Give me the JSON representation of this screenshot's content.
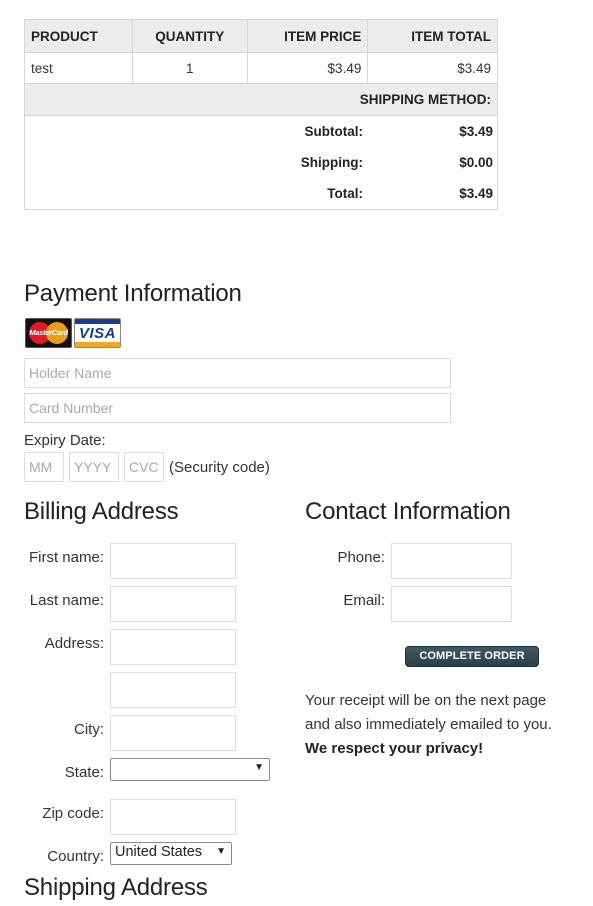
{
  "order_table": {
    "headers": [
      "PRODUCT",
      "QUANTITY",
      "ITEM PRICE",
      "ITEM TOTAL"
    ],
    "rows": [
      {
        "product": "test",
        "quantity": "1",
        "item_price": "$3.49",
        "item_total": "$3.49"
      }
    ],
    "shipping_method_label": "SHIPPING METHOD:",
    "totals": [
      {
        "label": "Subtotal:",
        "value": "$3.49"
      },
      {
        "label": "Shipping:",
        "value": "$0.00"
      },
      {
        "label": "Total:",
        "value": "$3.49"
      }
    ]
  },
  "payment": {
    "title": "Payment Information",
    "card_logos": [
      {
        "name": "mastercard-logo",
        "text": "MasterCard"
      },
      {
        "name": "visa-logo",
        "text": "VISA"
      }
    ],
    "holder_placeholder": "Holder Name",
    "card_placeholder": "Card Number",
    "expiry_label": "Expiry Date:",
    "mm_placeholder": "MM",
    "yyyy_placeholder": "YYYY",
    "cvc_placeholder": "CVC",
    "security_label": "(Security code)"
  },
  "billing": {
    "title": "Billing Address",
    "first_name_label": "First name:",
    "last_name_label": "Last name:",
    "address_label": "Address:",
    "city_label": "City:",
    "state_label": "State:",
    "state_value": "",
    "zip_label": "Zip code:",
    "country_label": "Country:",
    "country_value": "United States"
  },
  "contact": {
    "title": "Contact Information",
    "phone_label": "Phone:",
    "email_label": "Email:",
    "complete_button": "COMPLETE ORDER",
    "receipt_text": "Your receipt will be on the next page and also immediately emailed to you.",
    "privacy_text": "We respect your privacy!"
  },
  "shipping": {
    "title": "Shipping Address"
  },
  "colors": {
    "header_bg": "#ececec",
    "border": "#d6d6d6",
    "button_bg": "#2f4753",
    "text": "#333333"
  }
}
